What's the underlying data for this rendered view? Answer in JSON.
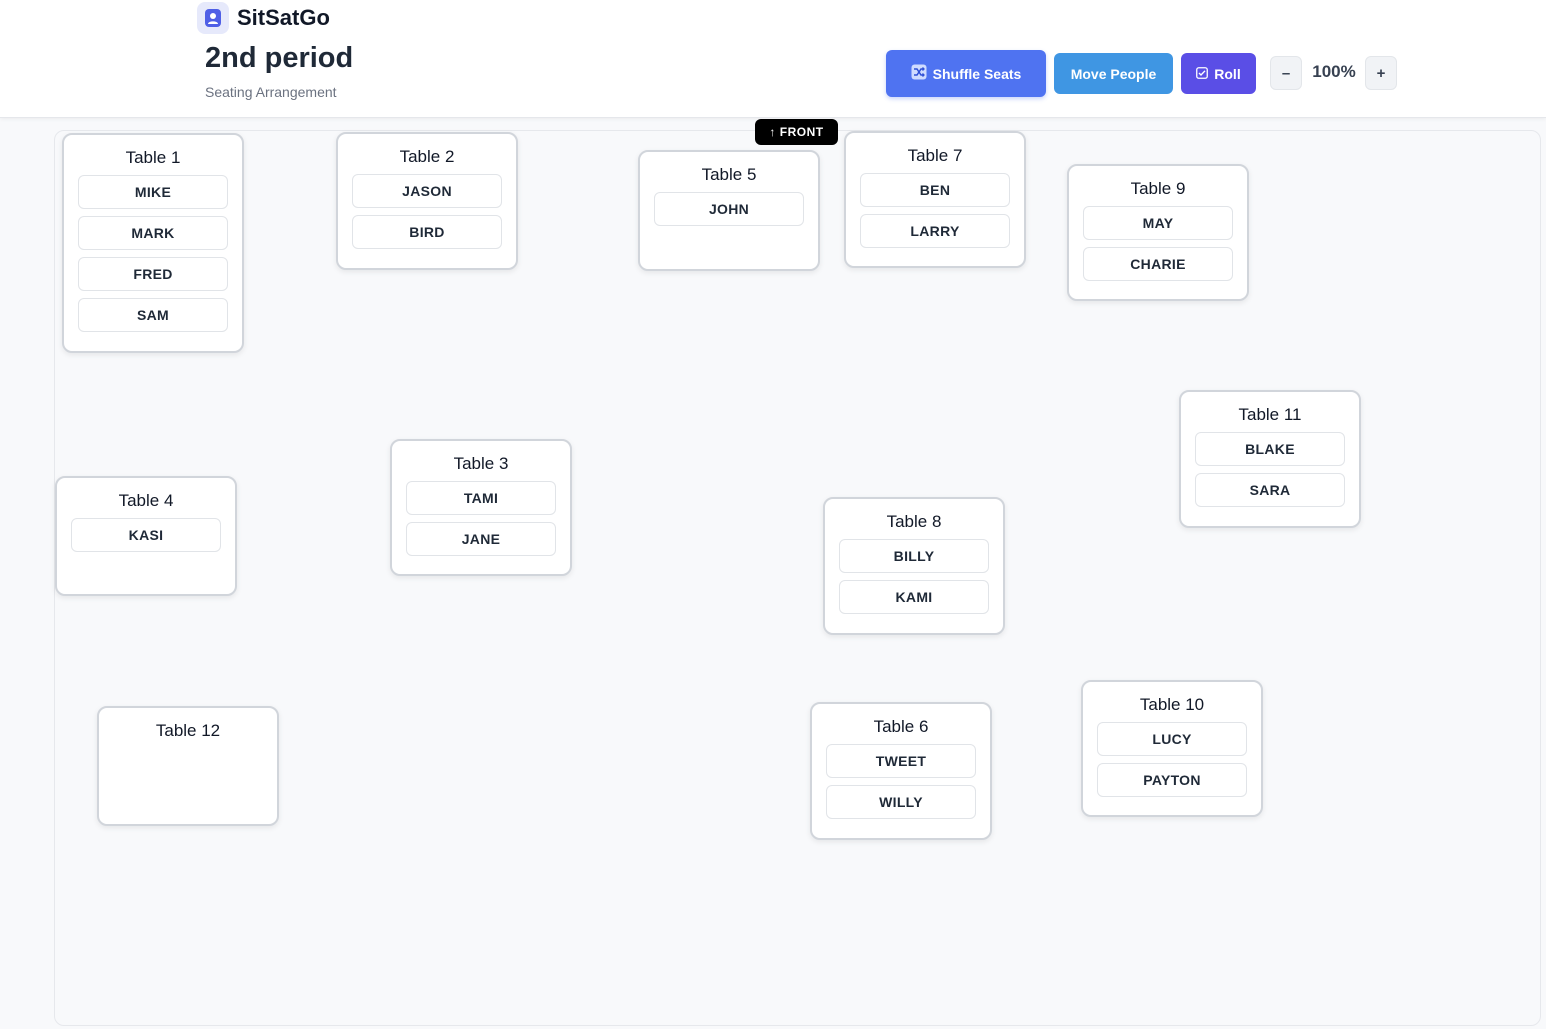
{
  "app": {
    "name": "SitSatGo"
  },
  "page": {
    "title": "2nd period",
    "subtitle": "Seating Arrangement"
  },
  "toolbar": {
    "shuffle_label": "Shuffle Seats",
    "move_label": "Move People",
    "roll_label": "Roll",
    "zoom_minus": "–",
    "zoom_level": "100%",
    "zoom_plus": "+"
  },
  "room": {
    "front_label": "↑ FRONT"
  },
  "tables": [
    {
      "name": "Table 1",
      "seats": [
        "MIKE",
        "MARK",
        "FRED",
        "SAM"
      ]
    },
    {
      "name": "Table 2",
      "seats": [
        "JASON",
        "BIRD"
      ]
    },
    {
      "name": "Table 5",
      "seats": [
        "JOHN"
      ]
    },
    {
      "name": "Table 7",
      "seats": [
        "BEN",
        "LARRY"
      ]
    },
    {
      "name": "Table 9",
      "seats": [
        "MAY",
        "CHARIE"
      ]
    },
    {
      "name": "Table 11",
      "seats": [
        "BLAKE",
        "SARA"
      ]
    },
    {
      "name": "Table 4",
      "seats": [
        "KASI"
      ]
    },
    {
      "name": "Table 3",
      "seats": [
        "TAMI",
        "JANE"
      ]
    },
    {
      "name": "Table 8",
      "seats": [
        "BILLY",
        "KAMI"
      ]
    },
    {
      "name": "Table 12",
      "seats": []
    },
    {
      "name": "Table 6",
      "seats": [
        "TWEET",
        "WILLY"
      ]
    },
    {
      "name": "Table 10",
      "seats": [
        "LUCY",
        "PAYTON"
      ]
    }
  ],
  "colors": {
    "shuffle": "#4f73f1",
    "move": "#3f96e3",
    "roll": "#5a4ee6",
    "brand_icon": "#4f5fe6"
  }
}
